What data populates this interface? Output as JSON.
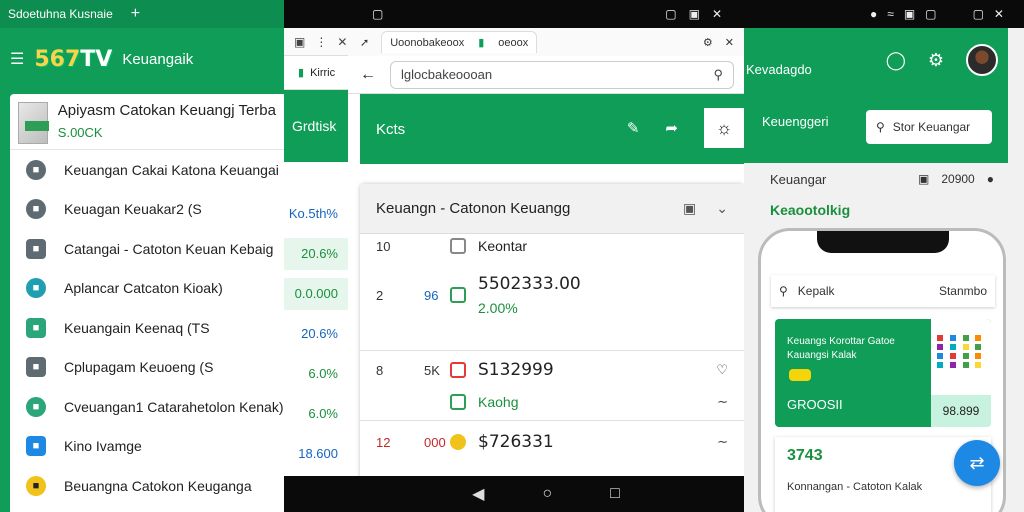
{
  "pane1": {
    "tab_title": "Sdoetuhna Kusnaie",
    "tab_add": "+",
    "logo_num": "567",
    "logo_suffix": "TV",
    "app_title": "Keuangaik",
    "header_title": "Apiyasm Catokan Keuangj Terba",
    "header_sub": "S.00CK",
    "items": [
      {
        "label": "Keuangan Cakai Katona Keuangai",
        "icon": "wrench-icon",
        "icon_class": "grey"
      },
      {
        "label": "Keuagan Keuakar2 (S",
        "icon": "search-icon",
        "icon_class": "grey"
      },
      {
        "label": "Catangai - Catoton Keuan Kebaig",
        "icon": "camera-icon",
        "icon_class": "grey sq"
      },
      {
        "label": "Aplancar Catcaton Kioak)",
        "icon": "wallet-icon",
        "icon_class": "teal"
      },
      {
        "label": "Keuangain Keenaq (TS",
        "icon": "chart-icon",
        "icon_class": "green sq"
      },
      {
        "label": "Cplupagam Keuoeng (S",
        "icon": "document-icon",
        "icon_class": "grey sq"
      },
      {
        "label": "Cveuangan1 Catarahetolon Kenak)",
        "icon": "tag-icon",
        "icon_class": "green"
      },
      {
        "label": "Kino Ivamge",
        "icon": "list-icon",
        "icon_class": "blue"
      },
      {
        "label": "Beuangna Catokon Keuganga",
        "icon": "coin-icon",
        "icon_class": "yellow"
      }
    ]
  },
  "pane2": {
    "tab_label": "Kirric",
    "green_label": "Grdtisk",
    "values": [
      "Ko.5th%",
      "20.6%",
      "0.0.000",
      "20.6%",
      "6.0%",
      "6.0%",
      "18.600"
    ]
  },
  "pane3": {
    "tab_title": "Uoonobakeoox",
    "tab_url": "oeoox",
    "address": "lglocbakeoooan",
    "green_title": "Kcts",
    "card_title": "Keuangn - Catonon Keuangg",
    "rows": [
      {
        "c1": "10",
        "c2": "",
        "main": "Keontar",
        "sub": "",
        "trail": ""
      },
      {
        "c1": "2",
        "c2": "96",
        "main": "5502333.00",
        "sub": "2.00%",
        "trail": ""
      },
      {
        "c1": "8",
        "c2": "5K",
        "main": "S132999",
        "sub": "",
        "trail": "♡"
      },
      {
        "c1": "",
        "c2": "",
        "main": "Kaohg",
        "sub": "",
        "trail": "∼"
      },
      {
        "c1": "12",
        "c2": "000",
        "main": "$726331",
        "sub": "",
        "trail": "∼"
      }
    ]
  },
  "pane4": {
    "title": "Kevadagdo",
    "mid_label": "Keuenggeri",
    "search_btn": "Stor Keuangar",
    "section_label": "Keuangar",
    "section_date": "20900",
    "section_label2": "Keaootolkig",
    "phone_search": "Kepalk",
    "phone_search_right": "Stanmbo",
    "card_text": "Keuangs Korottar Gatoe Kauangsi Kalak",
    "card_amount": "GROOSII",
    "card_side_amount": "98.899",
    "card2_num": "3743",
    "card2_text": "Konnangan - Catoton Kalak"
  },
  "colors": {
    "brand_green": "#0f9d58",
    "accent_blue": "#1e88e5",
    "accent_yellow": "#f1c21b"
  }
}
